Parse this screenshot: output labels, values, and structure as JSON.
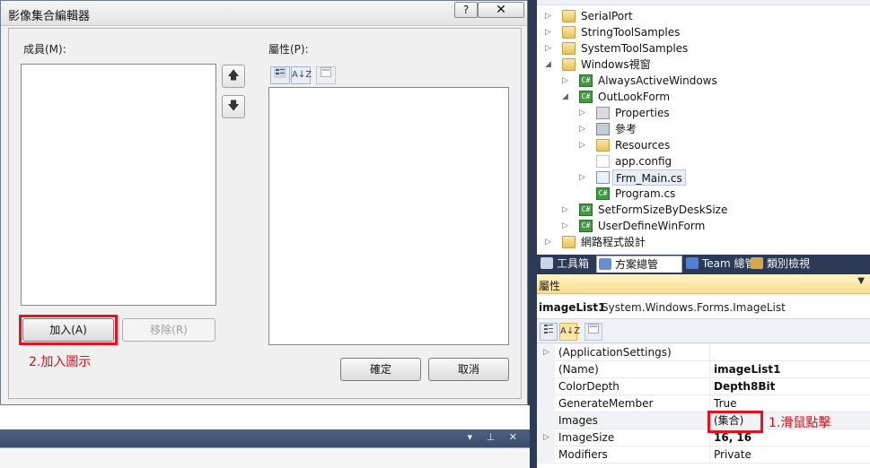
{
  "dialog": {
    "title": "影像集合編輯器",
    "help_label": "?",
    "close_label": "✕",
    "members_label": "成員(M):",
    "properties_label": "屬性(P):",
    "up_label": "🡅",
    "down_label": "🡇",
    "add_label": "加入(A)",
    "remove_label": "移除(R)",
    "ok_label": "確定",
    "cancel_label": "取消",
    "annotation_add": "2.加入圖示",
    "toolbar": {
      "categorized_icon": "categorized-icon",
      "alphabetical_label": "A↓Z",
      "pages_icon": "property-pages-icon"
    }
  },
  "bottom_bar": {
    "icons": "▾ ⊥ ✕"
  },
  "solution": {
    "items": [
      {
        "label": "SerialPort",
        "icon": "folder-icon",
        "expander": "▷"
      },
      {
        "label": "StringToolSamples",
        "icon": "folder-icon",
        "expander": "▷"
      },
      {
        "label": "SystemToolSamples",
        "icon": "folder-icon",
        "expander": "▷"
      },
      {
        "label": "Windows視窗",
        "icon": "folder-open-icon",
        "expander": "◢"
      },
      {
        "label": "AlwaysActiveWindows",
        "icon": "cs-project-icon",
        "expander": "▷"
      },
      {
        "label": "OutLookForm",
        "icon": "cs-project-icon",
        "expander": "◢"
      },
      {
        "label": "Properties",
        "icon": "properties-icon",
        "expander": "▷"
      },
      {
        "label": "參考",
        "icon": "references-icon",
        "expander": "▷"
      },
      {
        "label": "Resources",
        "icon": "folder-icon",
        "expander": "▷"
      },
      {
        "label": "app.config",
        "icon": "config-file-icon",
        "expander": ""
      },
      {
        "label": "Frm_Main.cs",
        "icon": "form-icon",
        "expander": "▷"
      },
      {
        "label": "Program.cs",
        "icon": "cs-file-icon",
        "expander": ""
      },
      {
        "label": "SetFormSizeByDeskSize",
        "icon": "cs-project-icon",
        "expander": "▷"
      },
      {
        "label": "UserDefineWinForm",
        "icon": "cs-project-icon",
        "expander": "▷"
      },
      {
        "label": "網路程式設計",
        "icon": "folder-icon",
        "expander": "▷"
      }
    ]
  },
  "tabs": [
    {
      "label": "工具箱",
      "icon": "toolbox-icon"
    },
    {
      "label": "方案總管",
      "icon": "solution-explorer-icon"
    },
    {
      "label": "Team 總管",
      "icon": "team-explorer-icon"
    },
    {
      "label": "類別檢視",
      "icon": "class-view-icon"
    }
  ],
  "properties": {
    "header": "屬性",
    "header_arrow": "▼",
    "object_name": "imageList1",
    "object_type": "System.Windows.Forms.ImageList",
    "toolbar": {
      "categorized_icon": "categorized-icon",
      "alphabetical_label": "A↓Z",
      "pages_icon": "property-pages-icon"
    },
    "rows": [
      {
        "name": "(ApplicationSettings)",
        "value": "",
        "expander": "▷"
      },
      {
        "name": "(Name)",
        "value": "imageList1",
        "expander": ""
      },
      {
        "name": "ColorDepth",
        "value": "Depth8Bit",
        "expander": ""
      },
      {
        "name": "GenerateMember",
        "value": "True",
        "expander": ""
      },
      {
        "name": "Images",
        "value": "(集合)",
        "expander": ""
      },
      {
        "name": "ImageSize",
        "value": "16, 16",
        "expander": "▷"
      },
      {
        "name": "Modifiers",
        "value": "Private",
        "expander": ""
      }
    ],
    "annotation_click": "1.滑鼠點擊"
  },
  "colors": {
    "annotation_red": "#e8101c",
    "panel_dark": "#2b3a55",
    "header_yellow": "#f8dd8a"
  }
}
